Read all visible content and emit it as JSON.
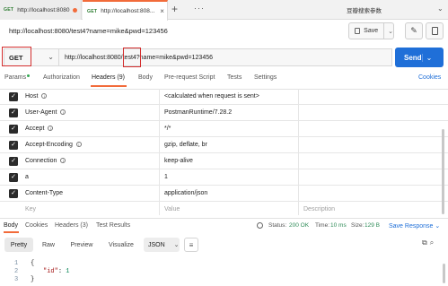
{
  "tabs": [
    {
      "method": "GET",
      "label": "http://localhost:8080"
    },
    {
      "method": "GET",
      "label": "http://localhost:808..."
    }
  ],
  "tabbar": {
    "plus": "+",
    "more": "···",
    "env_label": "豆瓣搜索参数",
    "env_chevron": "⌄"
  },
  "request": {
    "title": "http://localhost:8080/test4?name=mike&pwd=123456",
    "method": "GET",
    "url": "http://localhost:8080/test4?name=mike&pwd=123456",
    "save_label": "Save",
    "send_label": "Send"
  },
  "request_tabs": {
    "params": "Params",
    "authorization": "Authorization",
    "headers": "Headers (9)",
    "body": "Body",
    "prerequest": "Pre-request Script",
    "tests": "Tests",
    "settings": "Settings",
    "cookies": "Cookies"
  },
  "headers": [
    {
      "key": "Host",
      "value": "<calculated when request is sent>",
      "info": true
    },
    {
      "key": "User-Agent",
      "value": "PostmanRuntime/7.28.2",
      "info": true
    },
    {
      "key": "Accept",
      "value": "*/*",
      "info": true
    },
    {
      "key": "Accept-Encoding",
      "value": "gzip, deflate, br",
      "info": true
    },
    {
      "key": "Connection",
      "value": "keep-alive",
      "info": true
    },
    {
      "key": "a",
      "value": "1",
      "info": false
    },
    {
      "key": "Content-Type",
      "value": "application/json",
      "info": false
    }
  ],
  "headers_placeholder": {
    "key": "Key",
    "value": "Value",
    "description": "Description"
  },
  "response": {
    "tabs": {
      "body": "Body",
      "cookies": "Cookies",
      "headers": "Headers (3)",
      "test_results": "Test Results"
    },
    "status_label": "Status:",
    "status_value": "200 OK",
    "time_label": "Time:",
    "time_value": "10 ms",
    "size_label": "Size:",
    "size_value": "129 B",
    "save_response": "Save Response ⌄",
    "formats": {
      "pretty": "Pretty",
      "raw": "Raw",
      "preview": "Preview",
      "visualize": "Visualize"
    },
    "format_select": "JSON",
    "code_lines": [
      {
        "num": "1",
        "text": "{"
      },
      {
        "num": "2",
        "key": "\"id\"",
        "value": "1"
      },
      {
        "num": "3",
        "text": "}"
      }
    ]
  },
  "colors": {
    "accent": "#f26b3a",
    "send": "#1f6fd8",
    "status_ok": "#2e8b57",
    "method_get": "#2e7d32"
  }
}
